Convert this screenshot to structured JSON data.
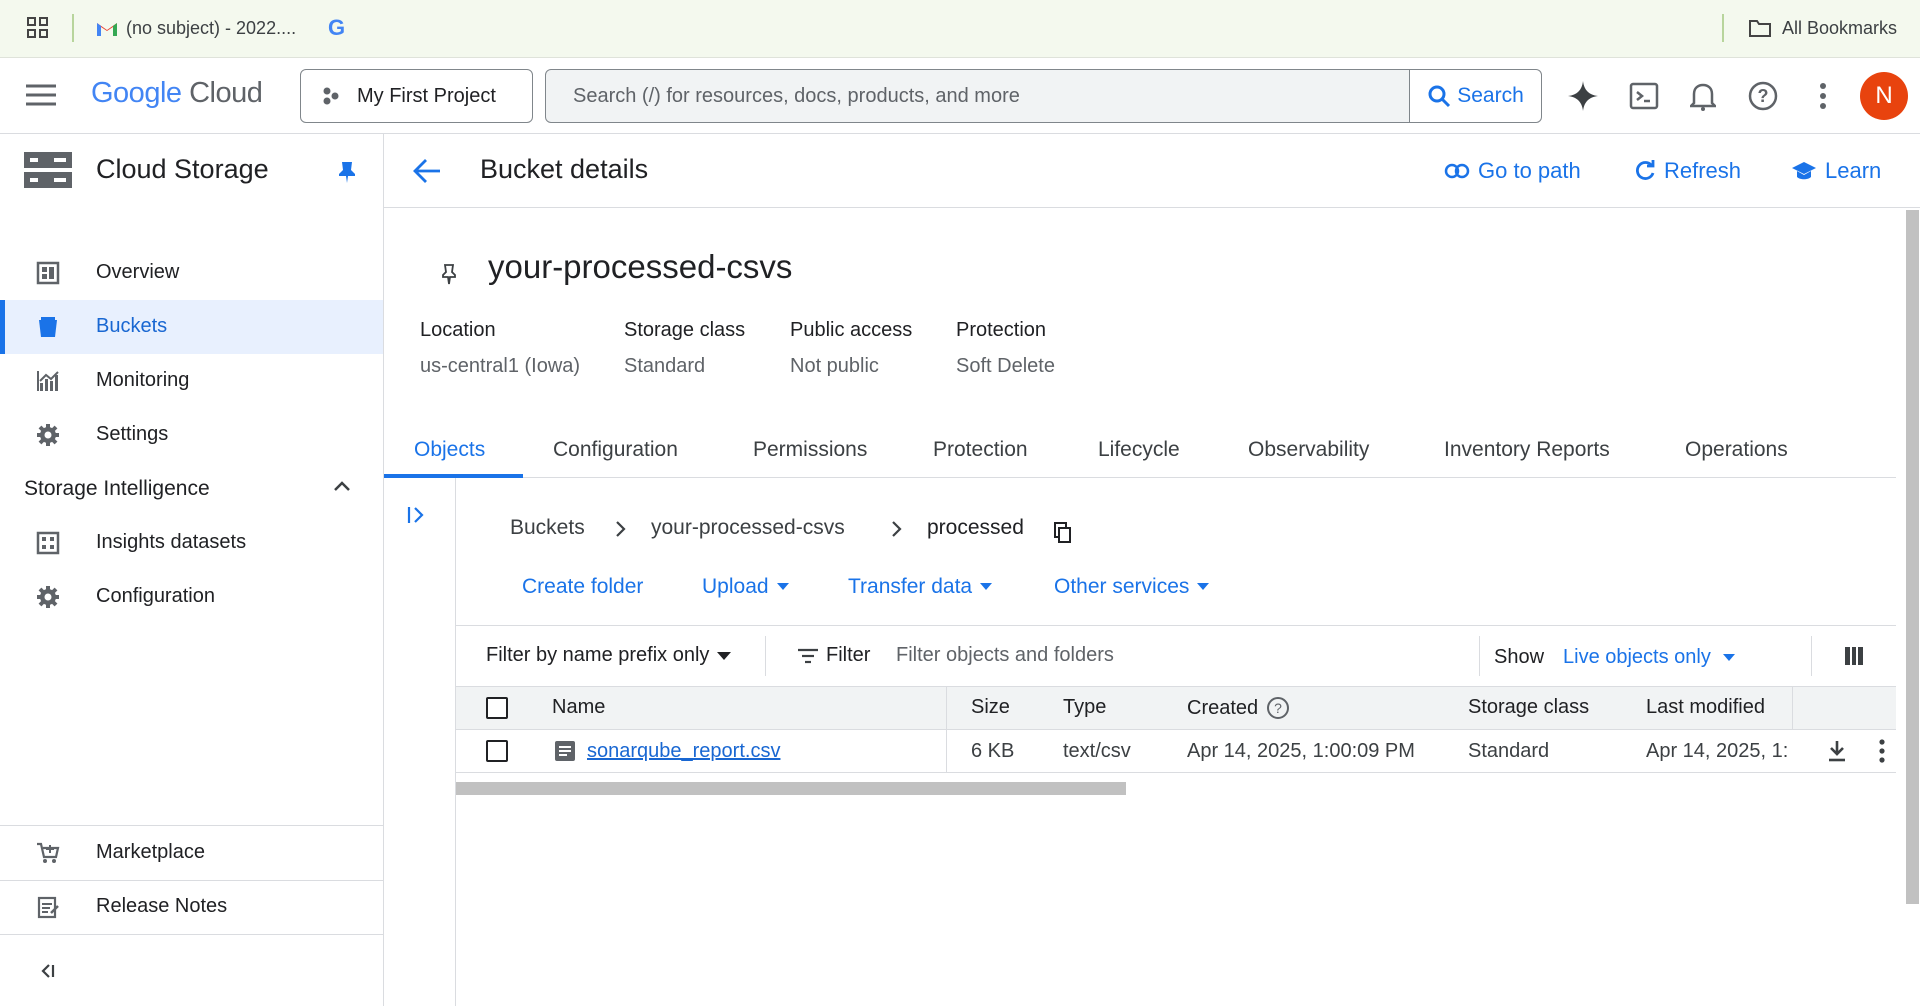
{
  "bookmarks": {
    "gmail_tab_label": "(no subject) - 2022....",
    "all_bookmarks_label": "All Bookmarks"
  },
  "topbar": {
    "logo_google": "Google",
    "logo_cloud": "Cloud",
    "project_label": "My First Project",
    "search_placeholder": "Search (/) for resources, docs, products, and more",
    "search_button_label": "Search",
    "avatar_initial": "N"
  },
  "sidebar": {
    "title": "Cloud Storage",
    "items": [
      {
        "label": "Overview",
        "icon": "dashboard-icon"
      },
      {
        "label": "Buckets",
        "icon": "bucket-icon",
        "active": true
      },
      {
        "label": "Monitoring",
        "icon": "chart-icon"
      },
      {
        "label": "Settings",
        "icon": "gear-icon"
      }
    ],
    "section_title": "Storage Intelligence",
    "section_items": [
      {
        "label": "Insights datasets",
        "icon": "dataset-icon"
      },
      {
        "label": "Configuration",
        "icon": "gear-icon"
      }
    ],
    "footer_items": [
      {
        "label": "Marketplace",
        "icon": "cart-icon"
      },
      {
        "label": "Release Notes",
        "icon": "notes-icon"
      }
    ]
  },
  "header": {
    "title": "Bucket details",
    "go_to_path": "Go to path",
    "refresh": "Refresh",
    "learn": "Learn"
  },
  "bucket": {
    "name": "your-processed-csvs",
    "meta": [
      {
        "label": "Location",
        "value": "us-central1 (Iowa)"
      },
      {
        "label": "Storage class",
        "value": "Standard"
      },
      {
        "label": "Public access",
        "value": "Not public"
      },
      {
        "label": "Protection",
        "value": "Soft Delete"
      }
    ]
  },
  "tabs": [
    "Objects",
    "Configuration",
    "Permissions",
    "Protection",
    "Lifecycle",
    "Observability",
    "Inventory Reports",
    "Operations"
  ],
  "breadcrumb": [
    "Buckets",
    "your-processed-csvs",
    "processed"
  ],
  "actions": {
    "create_folder": "Create folder",
    "upload": "Upload",
    "transfer_data": "Transfer data",
    "other_services": "Other services"
  },
  "filter": {
    "prefix_mode": "Filter by name prefix only",
    "filter_label": "Filter",
    "placeholder": "Filter objects and folders",
    "show_label": "Show",
    "show_value": "Live objects only"
  },
  "table": {
    "columns": [
      "Name",
      "Size",
      "Type",
      "Created",
      "Storage class",
      "Last modified"
    ],
    "rows": [
      {
        "name": "sonarqube_report.csv",
        "size": "6 KB",
        "type": "text/csv",
        "created": "Apr 14, 2025, 1:00:09 PM",
        "storage_class": "Standard",
        "last_modified": "Apr 14, 2025, 1:"
      }
    ]
  }
}
